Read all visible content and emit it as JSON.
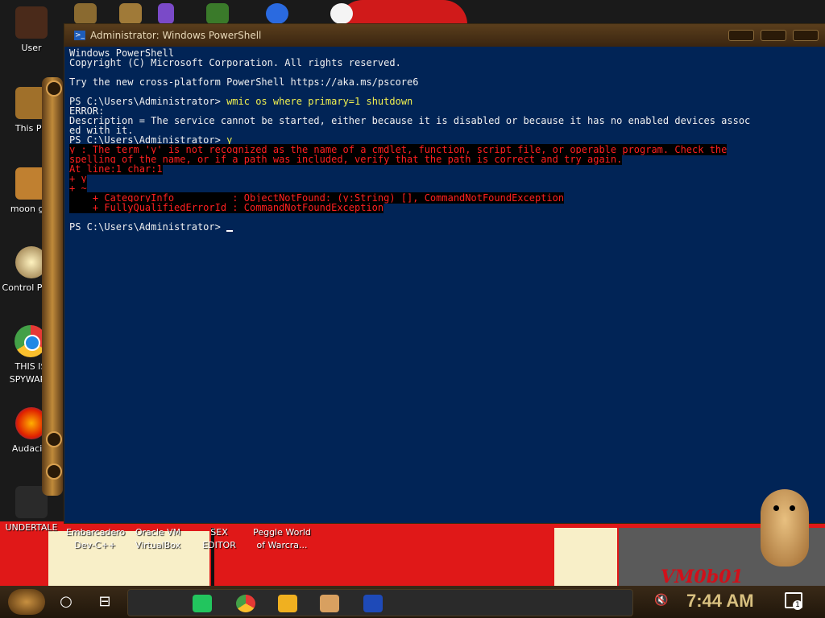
{
  "window": {
    "title": "Administrator: Windows PowerShell"
  },
  "console": {
    "lines": [
      {
        "text": "Windows PowerShell",
        "style": "normal"
      },
      {
        "text": "Copyright (C) Microsoft Corporation. All rights reserved.",
        "style": "normal"
      },
      {
        "text": "",
        "style": "normal"
      },
      {
        "text": "Try the new cross-platform PowerShell https://aka.ms/pscore6",
        "style": "normal"
      },
      {
        "text": "",
        "style": "normal"
      },
      {
        "prompt": "PS C:\\Users\\Administrator> ",
        "command": "wmic os where primary=1 shutdown",
        "style": "cmd"
      },
      {
        "text": "ERROR:",
        "style": "normal"
      },
      {
        "text": "Description = The service cannot be started, either because it is disabled or because it has no enabled devices assoc",
        "style": "normal"
      },
      {
        "text": "ed with it.",
        "style": "normal"
      },
      {
        "prompt": "PS C:\\Users\\Administrator> ",
        "command": "y",
        "style": "cmd"
      },
      {
        "text": "y : The term 'y' is not recognized as the name of a cmdlet, function, script file, or operable program. Check the",
        "style": "err"
      },
      {
        "text": "spelling of the name, or if a path was included, verify that the path is correct and try again.",
        "style": "err"
      },
      {
        "text": "At line:1 char:1",
        "style": "err"
      },
      {
        "text": "+ y",
        "style": "err"
      },
      {
        "text": "+ ~",
        "style": "err"
      },
      {
        "text": "    + CategoryInfo          : ObjectNotFound: (y:String) [], CommandNotFoundException",
        "style": "err"
      },
      {
        "text": "    + FullyQualifiedErrorId : CommandNotFoundException",
        "style": "err"
      },
      {
        "text": "",
        "style": "normal"
      },
      {
        "prompt": "PS C:\\Users\\Administrator> ",
        "command": "",
        "style": "cmd"
      }
    ]
  },
  "desktop_icons": [
    {
      "label": "User"
    },
    {
      "label": "This PC"
    },
    {
      "label": "moon girl"
    },
    {
      "label": "Control Panel"
    },
    {
      "label": "THIS IS SPYWARE"
    },
    {
      "label": "Audacity"
    },
    {
      "label": "UNDERTALE"
    }
  ],
  "bottom_icons": [
    {
      "label": "Embarcadero Dev-C++"
    },
    {
      "label": "Oracle VM VirtualBox"
    },
    {
      "label": "SEX EDITOR"
    },
    {
      "label": "Peggle World of Warcra..."
    }
  ],
  "wallpaper": {
    "watermark": "VM0b01"
  },
  "taskbar": {
    "clock": "7:44 AM",
    "notification_count": "1"
  },
  "colors": {
    "console_bg": "#012456",
    "error_fg": "#ff2020",
    "command_fg": "#f0f050"
  }
}
